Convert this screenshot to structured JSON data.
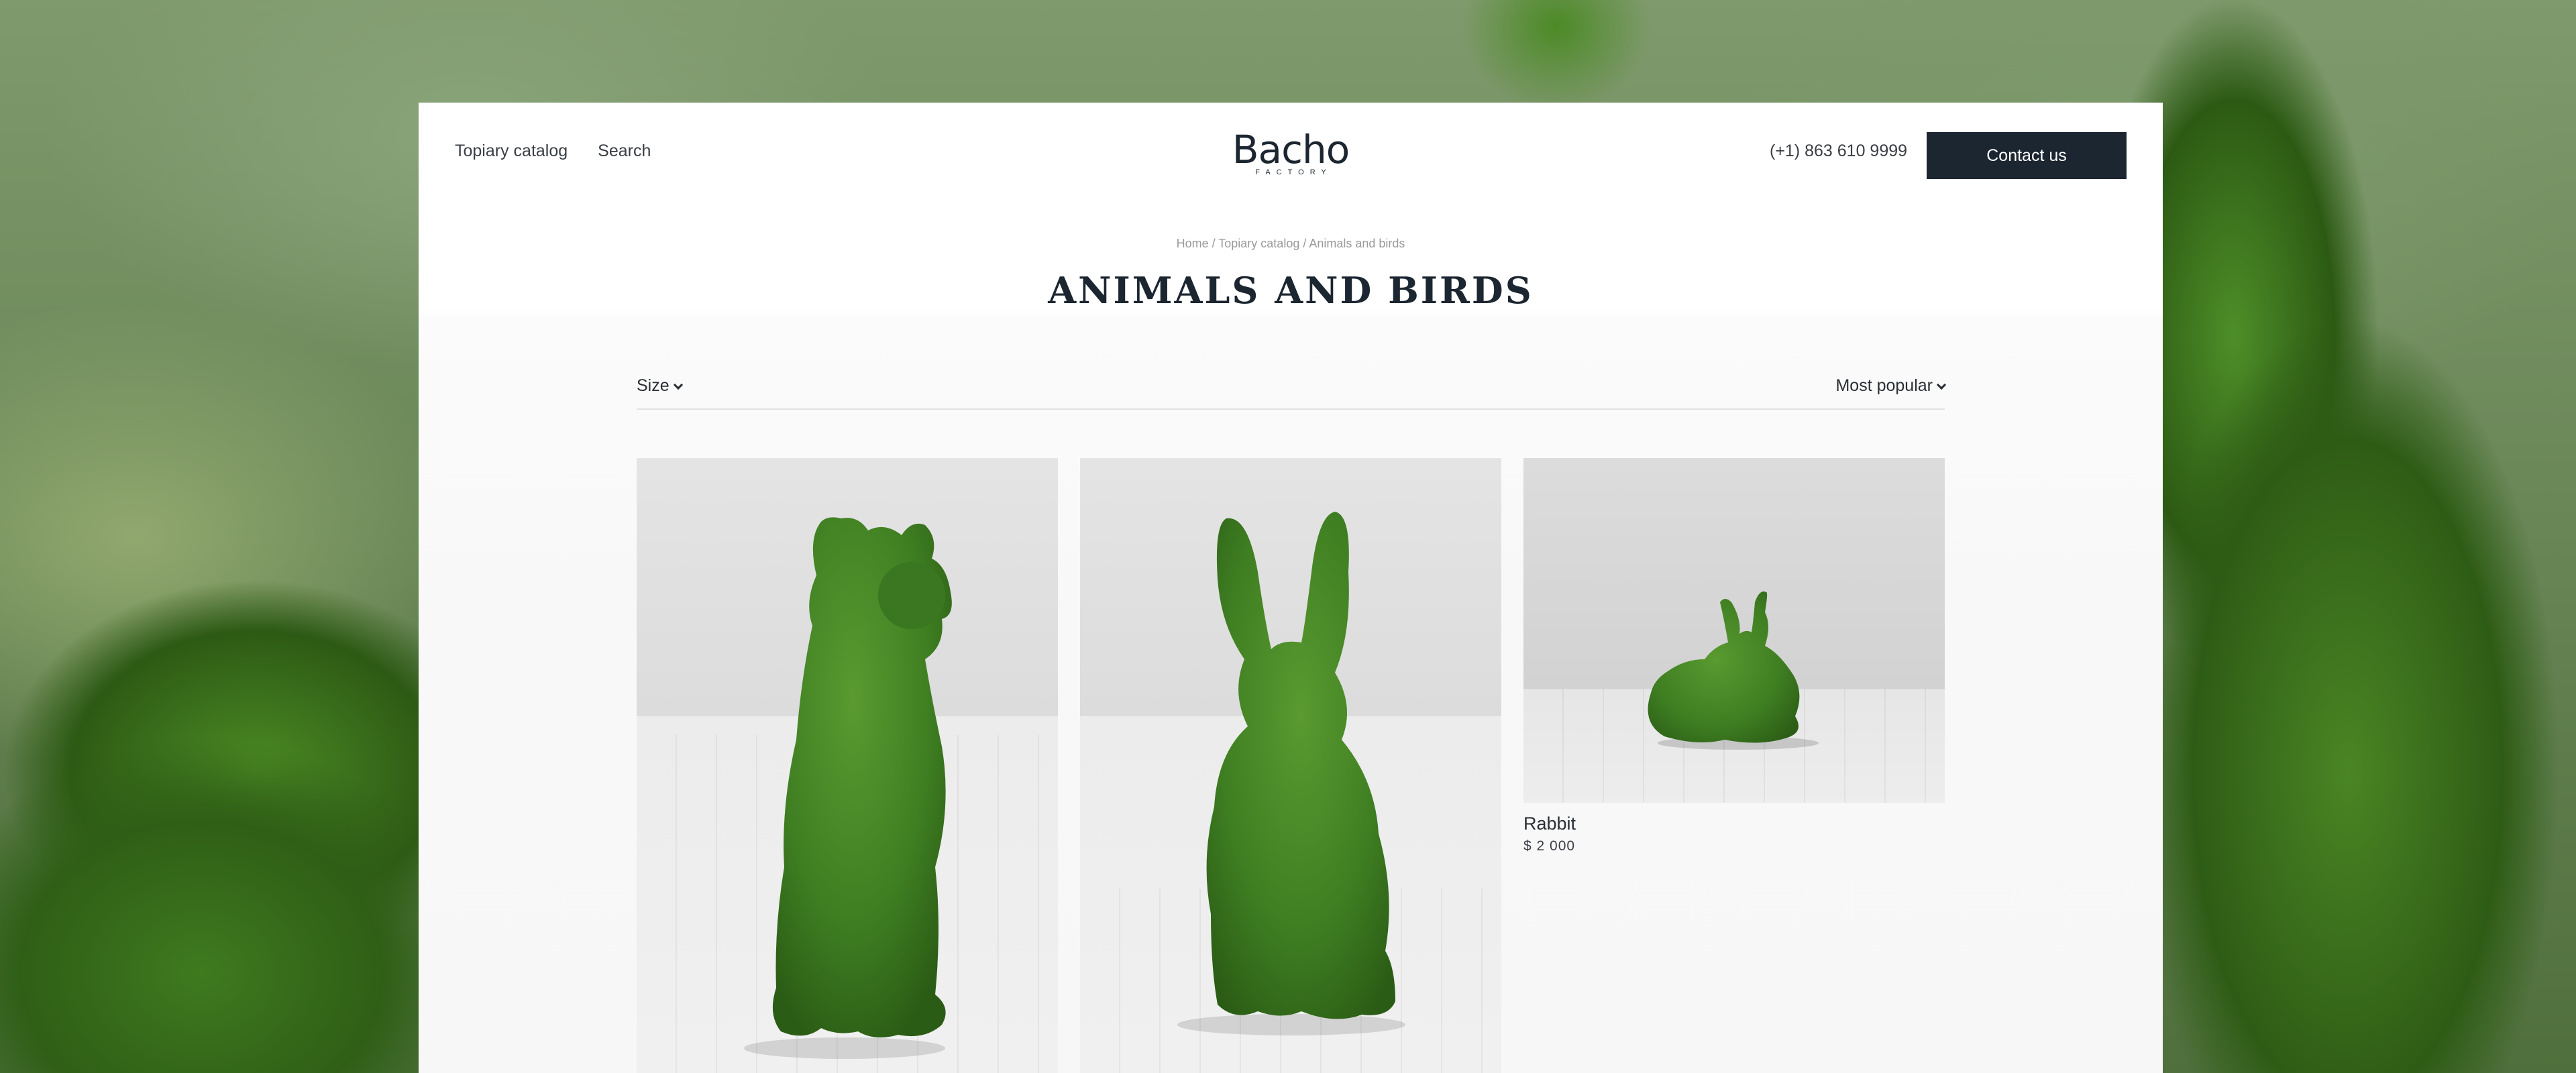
{
  "header": {
    "nav": [
      "Topiary catalog",
      "Search"
    ],
    "logo": {
      "name": "Bacho",
      "tagline": "FACTORY"
    },
    "phone": "(+1) 863 610 9999",
    "contact_label": "Contact us"
  },
  "breadcrumb": "Home / Topiary catalog / Animals and birds",
  "page_title": "ANIMALS AND BIRDS",
  "filters": {
    "size_label": "Size",
    "sort_label": "Most popular"
  },
  "products": [
    {
      "image": "green topiary dog sitting"
    },
    {
      "image": "green topiary rabbit sitting upright"
    },
    {
      "image": "green topiary rabbit lying",
      "name": "Rabbit",
      "price": "$ 2 000"
    }
  ],
  "colors": {
    "brand_dark": "#1c2631",
    "topiary_green": "#3f7f22",
    "card_bg": "#ffffff"
  }
}
